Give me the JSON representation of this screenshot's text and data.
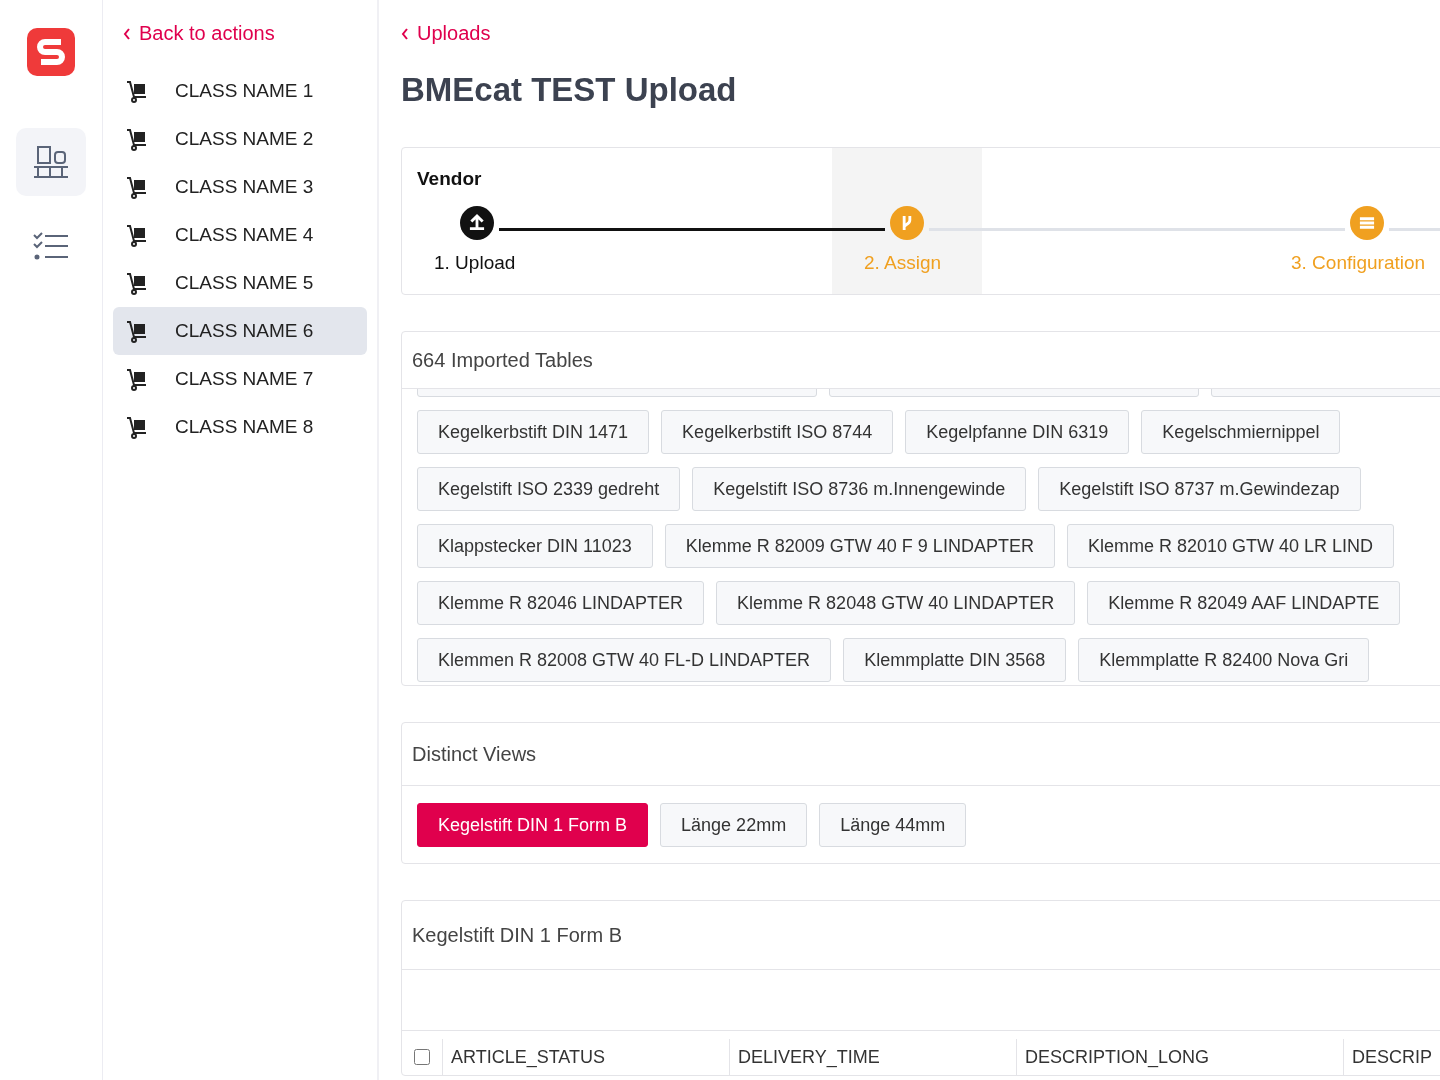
{
  "rail": {
    "items": [
      {
        "kind": "pallet",
        "selected": true
      },
      {
        "kind": "checklist",
        "selected": false
      }
    ]
  },
  "sidebar": {
    "back_link": "Back to actions",
    "items": [
      {
        "label": "CLASS NAME 1",
        "selected": false
      },
      {
        "label": "CLASS NAME 2",
        "selected": false
      },
      {
        "label": "CLASS NAME 3",
        "selected": false
      },
      {
        "label": "CLASS NAME 4",
        "selected": false
      },
      {
        "label": "CLASS NAME 5",
        "selected": false
      },
      {
        "label": "CLASS NAME 6",
        "selected": true
      },
      {
        "label": "CLASS NAME 7",
        "selected": false
      },
      {
        "label": "CLASS NAME 8",
        "selected": false
      }
    ]
  },
  "breadcrumb": "Uploads",
  "title": "BMEcat TEST Upload",
  "stepper": {
    "title": "Vendor",
    "steps": [
      {
        "label": "1. Upload",
        "kind": "upload",
        "completed": true,
        "selected": false
      },
      {
        "label": "2. Assign",
        "kind": "assign",
        "completed": false,
        "selected": true
      },
      {
        "label": "3. Configuration",
        "kind": "configuration",
        "completed": false,
        "selected": false
      }
    ]
  },
  "imported_tables": {
    "title": "664 Imported Tables",
    "rows": [
      [
        "Kegelkerbstift DIN 1471",
        "Kegelkerbstift ISO 8744",
        "Kegelpfanne DIN 6319",
        "Kegelschmiernippel"
      ],
      [
        "Kegelstift ISO 2339 gedreht",
        "Kegelstift ISO 8736 m.Innengewinde",
        "Kegelstift ISO 8737 m.Gewindezap"
      ],
      [
        "Klappstecker DIN 11023",
        "Klemme R 82009 GTW 40 F 9 LINDAPTER",
        "Klemme R 82010 GTW 40 LR LIND"
      ],
      [
        "Klemme R 82046 LINDAPTER",
        "Klemme R 82048 GTW 40 LINDAPTER",
        "Klemme R 82049 AAF LINDAPTE"
      ],
      [
        "Klemmen R 82008 GTW 40 FL-D LINDAPTER",
        "Klemmplatte DIN 3568",
        "Klemmplatte R 82400 Nova Gri"
      ]
    ]
  },
  "distinct_views": {
    "title": "Distinct Views",
    "items": [
      {
        "label": "Kegelstift DIN 1 Form B",
        "selected": true
      },
      {
        "label": "Länge 22mm",
        "selected": false
      },
      {
        "label": "Länge 44mm",
        "selected": false
      }
    ]
  },
  "table": {
    "title": "Kegelstift DIN 1 Form B",
    "select_all": {
      "checked": false
    },
    "columns": [
      "ARTICLE_STATUS",
      "DELIVERY_TIME",
      "DESCRIPTION_LONG",
      "DESCRIP"
    ]
  }
}
